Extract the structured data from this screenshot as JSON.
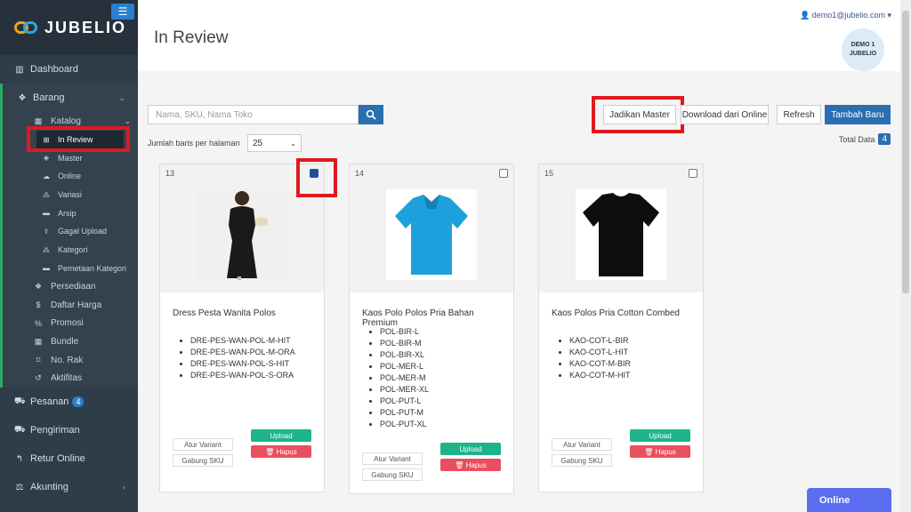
{
  "brand": {
    "name": "JUBELIO"
  },
  "header": {
    "title": "In Review",
    "user_email": "demo1@jubelio.com",
    "avatar_line1": "DEMO 1",
    "avatar_line2": "JUBELIO"
  },
  "sidebar": {
    "dashboard": "Dashboard",
    "barang": "Barang",
    "katalog": "Katalog",
    "katalog_items": [
      "In Review",
      "Master",
      "Online",
      "Variasi",
      "Arsip",
      "Gagal Upload",
      "Kategori",
      "Pemetaan Kategori"
    ],
    "barang_items": [
      "Persediaan",
      "Daftar Harga",
      "Promosi",
      "Bundle",
      "No. Rak",
      "Aktifitas"
    ],
    "pesanan": "Pesanan",
    "pesanan_count": "4",
    "pengiriman": "Pengiriman",
    "retur": "Retur Online",
    "akunting": "Akunting"
  },
  "toolbar": {
    "search_placeholder": "Nama, SKU, Nama Toko",
    "rows_label": "Jumlah baris per halaman",
    "rows_value": "25",
    "jadikan_master": "Jadikan Master",
    "download": "Download dari Online",
    "refresh": "Refresh",
    "tambah": "Tambah Baru",
    "total_label": "Total Data",
    "total_value": "4"
  },
  "cards": [
    {
      "id": "13",
      "checked": true,
      "name": "Dress Pesta Wanita Polos",
      "skus": [
        "DRE-PES-WAN-POL-M-HIT",
        "DRE-PES-WAN-POL-M-ORA",
        "DRE-PES-WAN-POL-S-HIT",
        "DRE-PES-WAN-POL-S-ORA"
      ]
    },
    {
      "id": "14",
      "checked": false,
      "name": "Kaos Polo Polos Pria Bahan Premium",
      "skus": [
        "POL-BIR-L",
        "POL-BIR-M",
        "POL-BIR-XL",
        "POL-MER-L",
        "POL-MER-M",
        "POL-MER-XL",
        "POL-PUT-L",
        "POL-PUT-M",
        "POL-PUT-XL"
      ]
    },
    {
      "id": "15",
      "checked": false,
      "name": "Kaos Polos Pria Cotton Combed",
      "skus": [
        "KAO-COT-L-BIR",
        "KAO-COT-L-HIT",
        "KAO-COT-M-BIR",
        "KAO-COT-M-HIT"
      ]
    }
  ],
  "card_actions": {
    "atur": "Atur Variant",
    "gabung": "Gabung SKU",
    "upload": "Upload",
    "hapus": "Hapus"
  },
  "chat": {
    "label": "Online"
  }
}
